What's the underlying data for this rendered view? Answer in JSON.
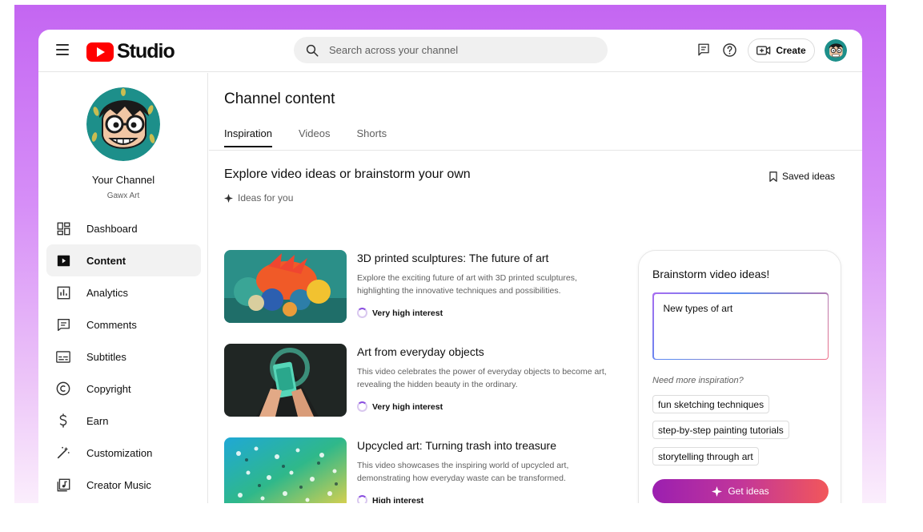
{
  "app": {
    "logo_text": "Studio",
    "brand_color": "#ff0000"
  },
  "header": {
    "search_placeholder": "Search across your channel",
    "create_label": "Create",
    "icons": [
      "menu-icon",
      "search-icon",
      "feedback-icon",
      "help-icon",
      "create-video-icon"
    ]
  },
  "sidebar": {
    "channel_name": "Your Channel",
    "channel_handle": "Gawx Art",
    "items": [
      {
        "label": "Dashboard",
        "icon": "dashboard-icon",
        "active": false
      },
      {
        "label": "Content",
        "icon": "content-icon",
        "active": true
      },
      {
        "label": "Analytics",
        "icon": "analytics-icon",
        "active": false
      },
      {
        "label": "Comments",
        "icon": "comments-icon",
        "active": false
      },
      {
        "label": "Subtitles",
        "icon": "subtitles-icon",
        "active": false
      },
      {
        "label": "Copyright",
        "icon": "copyright-icon",
        "active": false
      },
      {
        "label": "Earn",
        "icon": "earn-icon",
        "active": false
      },
      {
        "label": "Customization",
        "icon": "customization-icon",
        "active": false
      },
      {
        "label": "Creator Music",
        "icon": "creator-music-icon",
        "active": false
      }
    ]
  },
  "main": {
    "page_title": "Channel content",
    "tabs": [
      {
        "label": "Inspiration",
        "active": true
      },
      {
        "label": "Videos",
        "active": false
      },
      {
        "label": "Shorts",
        "active": false
      }
    ],
    "section_title": "Explore video ideas or brainstorm your own",
    "ideas_for_you": "Ideas for you",
    "saved_ideas": "Saved ideas",
    "ideas": [
      {
        "title": "3D printed sculptures: The future of art",
        "description": "Explore the exciting future of art with 3D printed sculptures, highlighting the innovative techniques and possibilities.",
        "interest": "Very high interest"
      },
      {
        "title": "Art from everyday objects",
        "description": "This video celebrates the power of everyday objects to become art, revealing the hidden beauty in the ordinary.",
        "interest": "Very high interest"
      },
      {
        "title": "Upcycled art: Turning trash into treasure",
        "description": "This video showcases the inspiring world of upcycled art, demonstrating how everyday waste can be transformed.",
        "interest": "High interest"
      }
    ]
  },
  "brainstorm": {
    "title": "Brainstorm video ideas!",
    "input_value": "New types of art",
    "need_more": "Need more inspiration?",
    "chips": [
      "fun sketching techniques",
      "step-by-step painting tutorials",
      "storytelling through art"
    ],
    "button_label": "Get ideas"
  }
}
